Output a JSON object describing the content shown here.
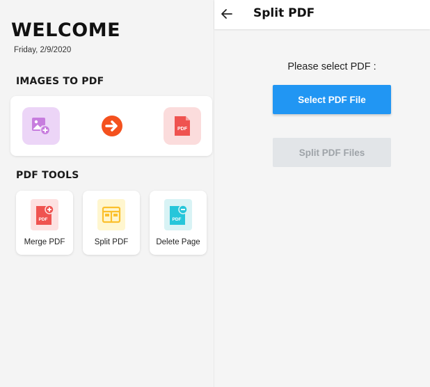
{
  "home": {
    "title": "WELCOME",
    "date": "Friday, 2/9/2020",
    "images_section": {
      "title": "IMAGES TO PDF",
      "pdf_badge": "PDF"
    },
    "tools_section": {
      "title": "PDF TOOLS",
      "tools": [
        {
          "label": "Merge PDF",
          "icon": "merge-pdf-icon",
          "badge": "PDF"
        },
        {
          "label": "Split PDF",
          "icon": "split-pdf-icon"
        },
        {
          "label": "Delete Page",
          "icon": "delete-page-icon",
          "badge": "PDF"
        }
      ]
    }
  },
  "split_screen": {
    "title": "Split PDF",
    "prompt": "Please select PDF :",
    "select_button": "Select PDF File",
    "split_button": "Split PDF Files"
  },
  "colors": {
    "primary_blue": "#2196f3",
    "arrow_orange": "#f4511e",
    "pdf_red": "#ef5350",
    "image_purple": "#c77dde",
    "split_yellow": "#fbc02d",
    "delete_teal": "#26c6da"
  }
}
